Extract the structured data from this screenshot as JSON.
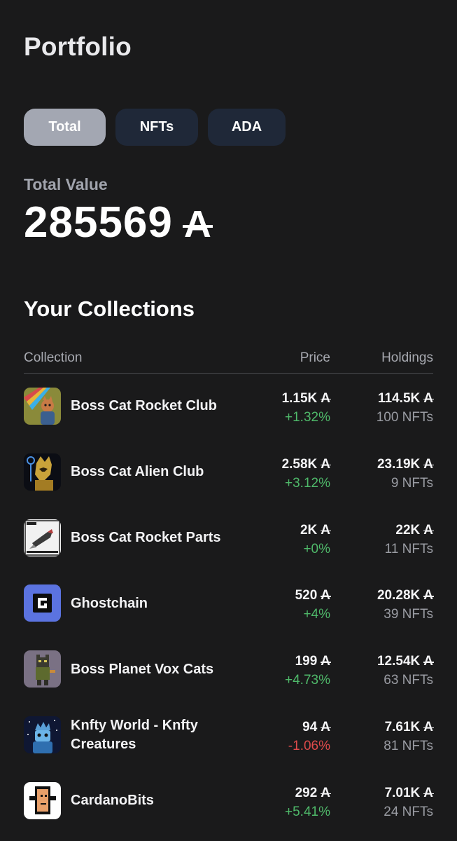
{
  "header": {
    "title": "Portfolio"
  },
  "tabs": [
    {
      "label": "Total",
      "active": true
    },
    {
      "label": "NFTs",
      "active": false
    },
    {
      "label": "ADA",
      "active": false
    }
  ],
  "summary": {
    "label": "Total Value",
    "value": "285569",
    "currency_symbol": "A"
  },
  "collections": {
    "title": "Your Collections",
    "columns": {
      "collection": "Collection",
      "price": "Price",
      "holdings": "Holdings"
    },
    "rows": [
      {
        "name": "Boss Cat Rocket Club",
        "price": "1.15K",
        "change": "+1.32%",
        "change_dir": "pos",
        "holdings_value": "114.5K",
        "holdings_count": "100 NFTs",
        "icon": "boss-cat-rocket-club-icon"
      },
      {
        "name": "Boss Cat Alien Club",
        "price": "2.58K",
        "change": "+3.12%",
        "change_dir": "pos",
        "holdings_value": "23.19K",
        "holdings_count": "9 NFTs",
        "icon": "boss-cat-alien-club-icon"
      },
      {
        "name": "Boss Cat Rocket Parts",
        "price": "2K",
        "change": "+0%",
        "change_dir": "pos",
        "holdings_value": "22K",
        "holdings_count": "11 NFTs",
        "icon": "boss-cat-rocket-parts-icon"
      },
      {
        "name": "Ghostchain",
        "price": "520",
        "change": "+4%",
        "change_dir": "pos",
        "holdings_value": "20.28K",
        "holdings_count": "39 NFTs",
        "icon": "ghostchain-icon"
      },
      {
        "name": "Boss Planet Vox Cats",
        "price": "199",
        "change": "+4.73%",
        "change_dir": "pos",
        "holdings_value": "12.54K",
        "holdings_count": "63 NFTs",
        "icon": "boss-planet-vox-cats-icon"
      },
      {
        "name": "Knfty World - Knfty Creatures",
        "price": "94",
        "change": "-1.06%",
        "change_dir": "neg",
        "holdings_value": "7.61K",
        "holdings_count": "81 NFTs",
        "icon": "knfty-creatures-icon"
      },
      {
        "name": "CardanoBits",
        "price": "292",
        "change": "+5.41%",
        "change_dir": "pos",
        "holdings_value": "7.01K",
        "holdings_count": "24 NFTs",
        "icon": "cardanobits-icon"
      }
    ]
  },
  "colors": {
    "background": "#1a1a1b",
    "tab_active": "#a3a7b2",
    "tab_inactive": "#1f2838",
    "positive": "#4fb96a",
    "negative": "#de4b4b"
  }
}
